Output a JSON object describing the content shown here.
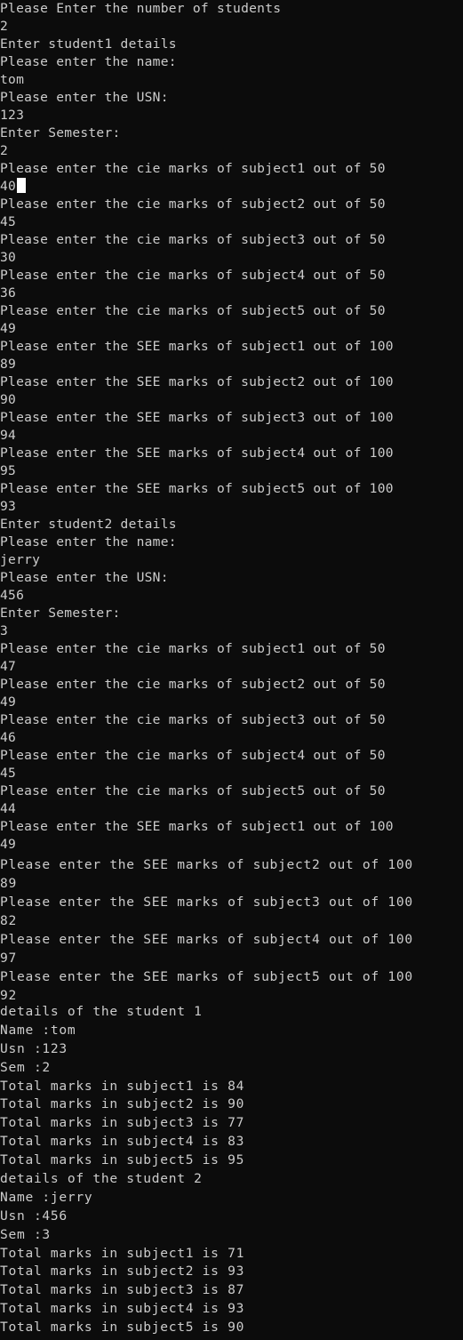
{
  "console": {
    "cursor_char": "",
    "block_a": [
      "Please Enter the number of students",
      "2",
      "Enter student1 details",
      "Please enter the name:",
      "tom",
      "Please enter the USN:",
      "123",
      "Enter Semester:",
      "2",
      "Please enter the cie marks of subject1 out of 50",
      "40",
      "Please enter the cie marks of subject2 out of 50",
      "45",
      "Please enter the cie marks of subject3 out of 50",
      "30",
      "Please enter the cie marks of subject4 out of 50",
      "36",
      "Please enter the cie marks of subject5 out of 50",
      "49",
      "Please enter the SEE marks of subject1 out of 100",
      "89",
      "Please enter the SEE marks of subject2 out of 100",
      "90",
      "Please enter the SEE marks of subject3 out of 100",
      "94",
      "Please enter the SEE marks of subject4 out of 100",
      "95",
      "Please enter the SEE marks of subject5 out of 100",
      "93",
      "Enter student2 details",
      "Please enter the name:",
      "jerry",
      "Please enter the USN:",
      "456",
      "Enter Semester:",
      "3",
      "Please enter the cie marks of subject1 out of 50",
      "47",
      "Please enter the cie marks of subject2 out of 50",
      "49",
      "Please enter the cie marks of subject3 out of 50",
      "46",
      "Please enter the cie marks of subject4 out of 50",
      "45",
      "Please enter the cie marks of subject5 out of 50",
      "44",
      "Please enter the SEE marks of subject1 out of 100",
      "49"
    ],
    "block_b": [
      "Please enter the SEE marks of subject2 out of 100",
      "89",
      "Please enter the SEE marks of subject3 out of 100",
      "82",
      "Please enter the SEE marks of subject4 out of 100",
      "97",
      "Please enter the SEE marks of subject5 out of 100",
      "92"
    ],
    "block_c": [
      "details of the student 1",
      "Name :tom",
      "Usn :123",
      "Sem :2",
      "Total marks in subject1 is 84",
      "Total marks in subject2 is 90",
      "Total marks in subject3 is 77",
      "Total marks in subject4 is 83",
      "Total marks in subject5 is 95",
      "details of the student 2",
      "Name :jerry",
      "Usn :456",
      "Sem :3",
      "Total marks in subject1 is 71",
      "Total marks in subject2 is 93",
      "Total marks in subject3 is 87",
      "Total marks in subject4 is 93",
      "Total marks in subject5 is 90"
    ]
  }
}
